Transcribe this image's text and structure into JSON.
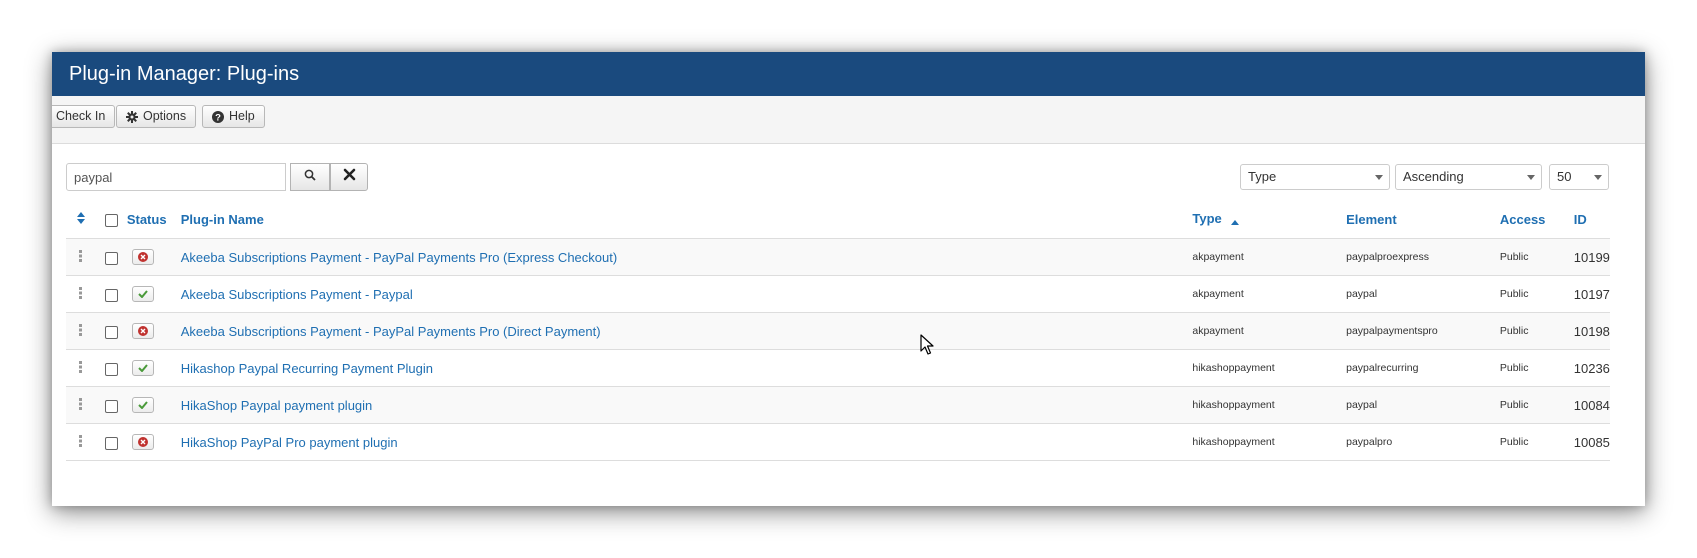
{
  "header": {
    "title": "Plug-in Manager: Plug-ins"
  },
  "toolbar": {
    "checkin_label": "Check In",
    "options_label": "Options",
    "help_label": "Help"
  },
  "search": {
    "value": "paypal"
  },
  "filters": {
    "sort_field": "Type",
    "sort_direction": "Ascending",
    "limit": "50"
  },
  "table": {
    "headers": {
      "status": "Status",
      "name": "Plug-in Name",
      "type": "Type",
      "element": "Element",
      "access": "Access",
      "id": "ID"
    },
    "rows": [
      {
        "enabled": false,
        "name": "Akeeba Subscriptions Payment - PayPal Payments Pro (Express Checkout)",
        "type": "akpayment",
        "element": "paypalproexpress",
        "access": "Public",
        "id": "10199"
      },
      {
        "enabled": true,
        "name": "Akeeba Subscriptions Payment - Paypal",
        "type": "akpayment",
        "element": "paypal",
        "access": "Public",
        "id": "10197"
      },
      {
        "enabled": false,
        "name": "Akeeba Subscriptions Payment - PayPal Payments Pro (Direct Payment)",
        "type": "akpayment",
        "element": "paypalpaymentspro",
        "access": "Public",
        "id": "10198"
      },
      {
        "enabled": true,
        "name": "Hikashop Paypal Recurring Payment Plugin",
        "type": "hikashoppayment",
        "element": "paypalrecurring",
        "access": "Public",
        "id": "10236"
      },
      {
        "enabled": true,
        "name": "HikaShop Paypal payment plugin",
        "type": "hikashoppayment",
        "element": "paypal",
        "access": "Public",
        "id": "10084"
      },
      {
        "enabled": false,
        "name": "HikaShop PayPal Pro payment plugin",
        "type": "hikashoppayment",
        "element": "paypalpro",
        "access": "Public",
        "id": "10085"
      }
    ]
  },
  "icons": {
    "enabled": "check-icon",
    "disabled": "circle-x-icon",
    "sort_active": "caret-up-icon",
    "ordering": "sort-icon"
  },
  "colors": {
    "header_bg": "#1a4a7e",
    "link": "#1f6fb2",
    "enabled": "#4a9a3a",
    "disabled": "#c0322f"
  }
}
